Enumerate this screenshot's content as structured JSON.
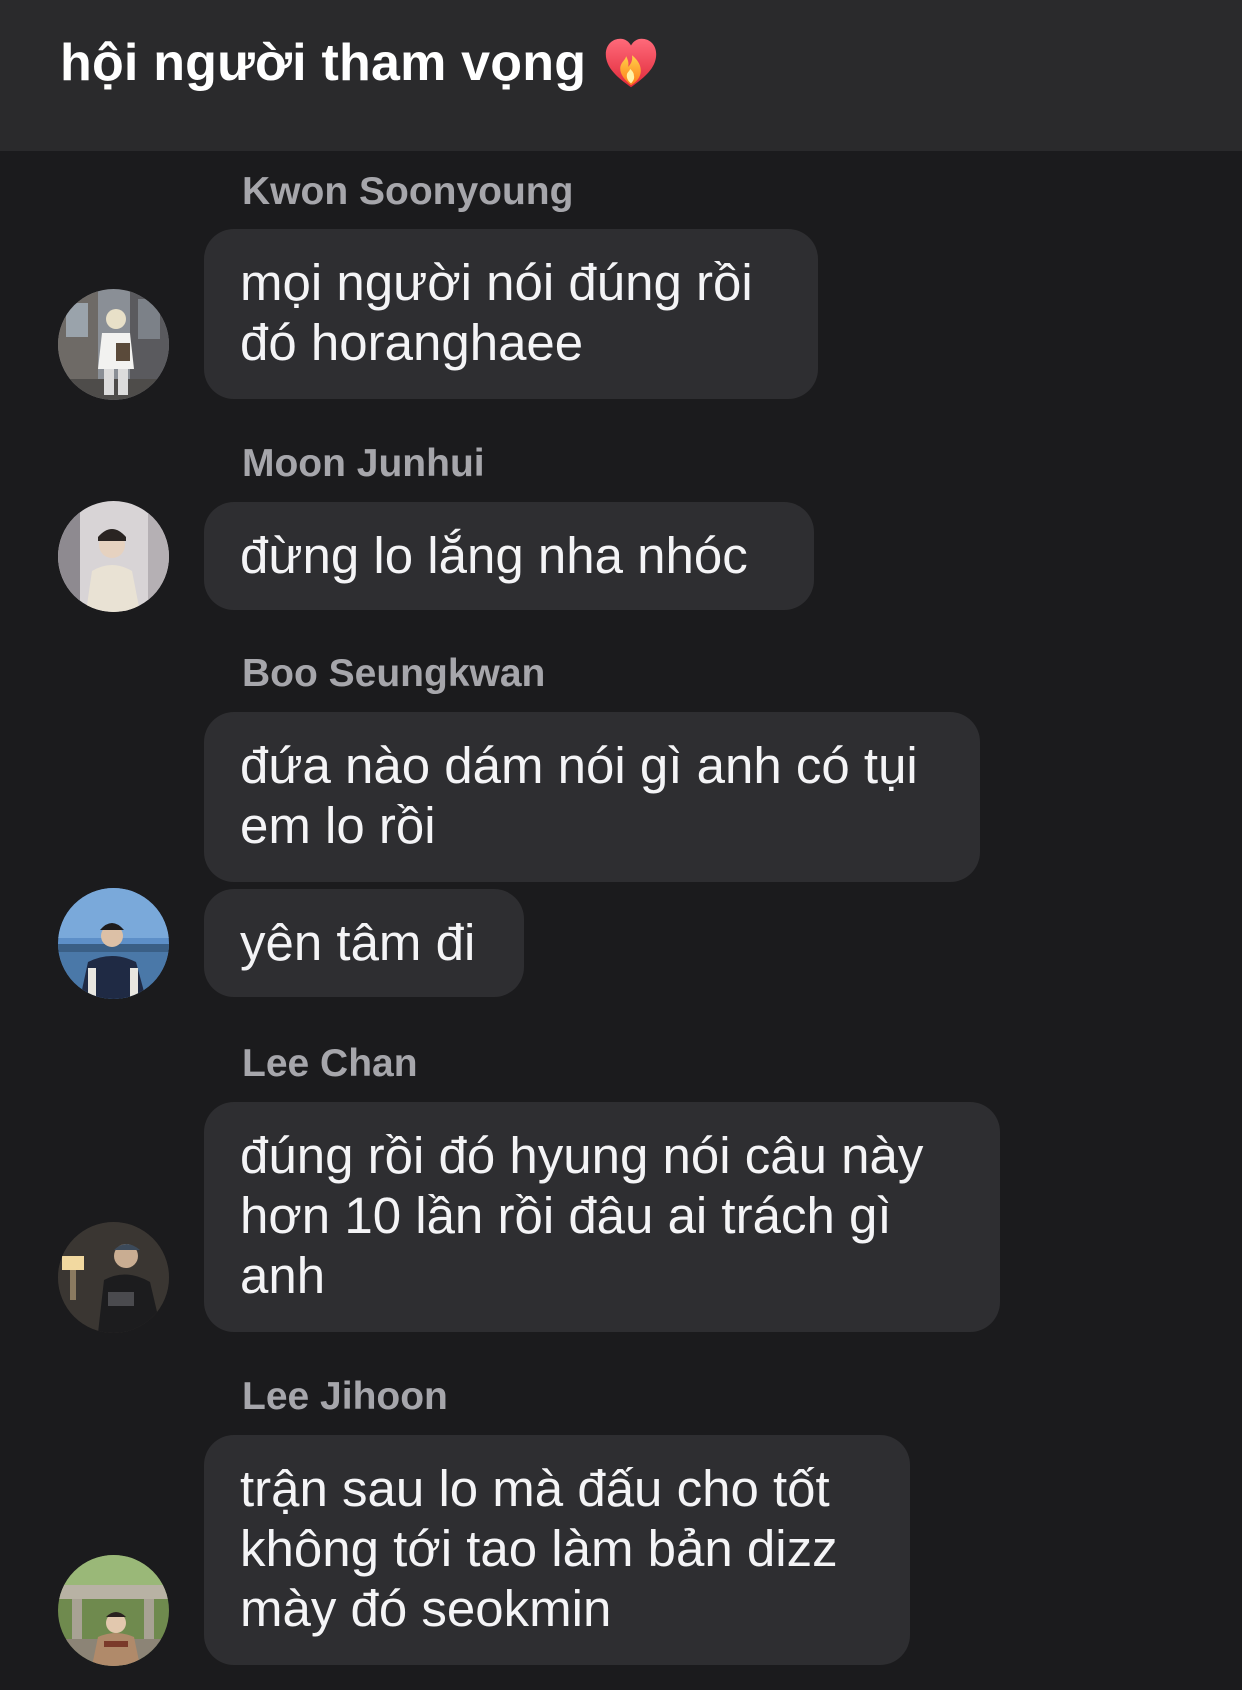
{
  "header": {
    "title": "hội người tham vọng",
    "emoji_icon": "heart-on-fire-icon"
  },
  "messages": [
    {
      "sender": "Kwon Soonyoung",
      "avatar_icon": "avatar-kwon-soonyoung",
      "bubbles": [
        {
          "lines": [
            "mọi người nói đúng rồi",
            "đó horanghaee"
          ]
        }
      ]
    },
    {
      "sender": "Moon Junhui",
      "avatar_icon": "avatar-moon-junhui",
      "bubbles": [
        {
          "lines": [
            "đừng lo lắng nha nhóc"
          ]
        }
      ]
    },
    {
      "sender": "Boo Seungkwan",
      "avatar_icon": "avatar-boo-seungkwan",
      "bubbles": [
        {
          "lines": [
            "đứa nào dám nói gì anh có tụi",
            "em lo rồi"
          ]
        },
        {
          "lines": [
            "yên tâm đi"
          ]
        }
      ]
    },
    {
      "sender": "Lee Chan",
      "avatar_icon": "avatar-lee-chan",
      "bubbles": [
        {
          "lines": [
            "đúng rồi đó hyung nói câu này",
            "hơn 10 lần rồi đâu ai trách gì",
            "anh"
          ]
        }
      ]
    },
    {
      "sender": "Lee Jihoon",
      "avatar_icon": "avatar-lee-jihoon",
      "bubbles": [
        {
          "lines": [
            "trận sau lo mà đấu cho tốt",
            "không tới tao làm bản dizz",
            "mày đó seokmin"
          ]
        }
      ]
    }
  ],
  "colors": {
    "background": "#1b1b1d",
    "header": "#2a2a2c",
    "bubble": "#2e2e31",
    "sender_name": "#a6a6ab",
    "text": "#f4f4f6"
  }
}
